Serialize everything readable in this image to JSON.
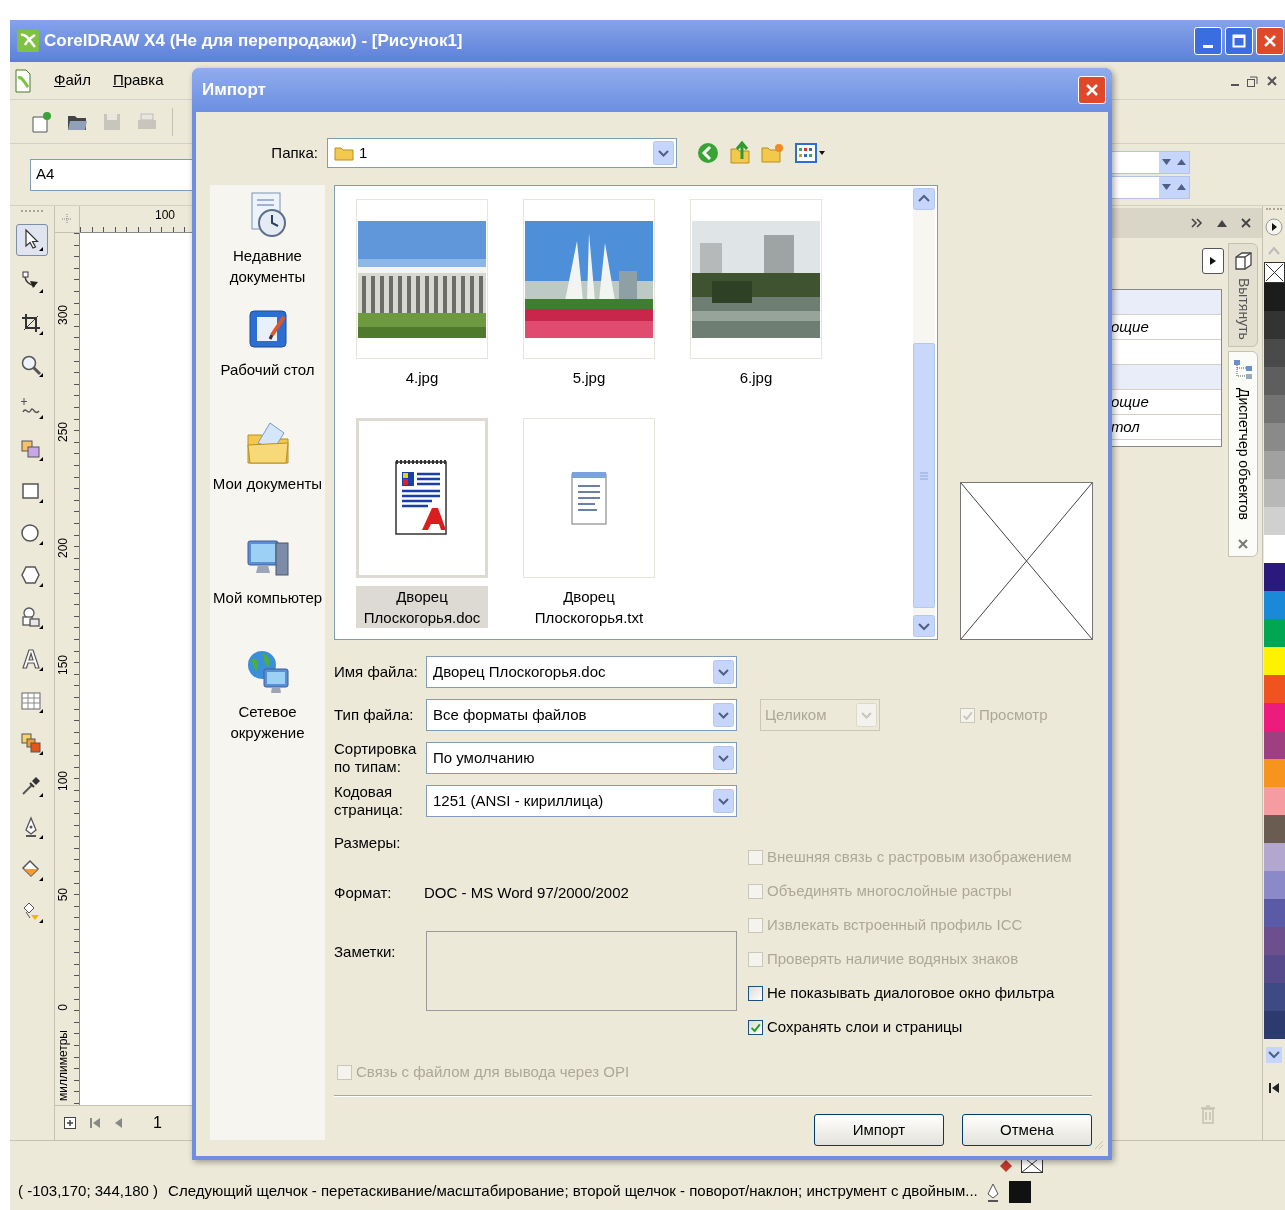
{
  "app": {
    "title": "CorelDRAW X4 (Не для перепродажи) - [Рисунок1]",
    "menu": [
      "Файл",
      "Правка"
    ],
    "page_size": "A4",
    "tools": [
      {
        "selected": true
      },
      {
        "selected": false
      },
      {
        "selected": false
      },
      {
        "selected": false
      },
      {
        "selected": false
      },
      {
        "selected": false
      },
      {
        "selected": false
      },
      {
        "selected": false
      },
      {
        "selected": false
      },
      {
        "selected": false
      },
      {
        "selected": false
      },
      {
        "selected": false
      },
      {
        "selected": false
      },
      {
        "selected": false
      },
      {
        "selected": false
      },
      {
        "selected": false
      },
      {
        "selected": false
      }
    ],
    "ruler": {
      "h_labels": [
        "100"
      ],
      "v_labels": [
        "300",
        "250",
        "200",
        "150",
        "100",
        "50",
        "0"
      ],
      "unit": "миллиметры"
    },
    "page_nav": "1",
    "docker": {
      "rows": [
        {
          "kind": "group"
        },
        {
          "kind": "item",
          "text": "ощие"
        },
        {
          "kind": "item"
        },
        {
          "kind": "group"
        },
        {
          "kind": "item",
          "text": "ощие"
        },
        {
          "kind": "item",
          "text": "тол"
        }
      ],
      "tabs": [
        {
          "label": "Вытянуть",
          "selected": false
        },
        {
          "label": "Диспетчер объектов",
          "selected": true
        }
      ]
    },
    "palette": [
      {
        "color": "#1c1c1c"
      },
      {
        "color": "#333333"
      },
      {
        "color": "#4a4a4a"
      },
      {
        "color": "#5e5e5e"
      },
      {
        "color": "#737373"
      },
      {
        "color": "#8a8a8a"
      },
      {
        "color": "#a1a1a1"
      },
      {
        "color": "#b8b8b8"
      },
      {
        "color": "#d0d0d0"
      },
      {
        "color": "#ffffff"
      },
      {
        "color": "#2b1a7c"
      },
      {
        "color": "#1a8ad8"
      },
      {
        "color": "#00a651"
      },
      {
        "color": "#fff200"
      },
      {
        "color": "#f0541e"
      },
      {
        "color": "#ec1c7d"
      },
      {
        "color": "#9e3f80"
      },
      {
        "color": "#f7941d"
      },
      {
        "color": "#f49ca0"
      },
      {
        "color": "#6b5c52"
      },
      {
        "color": "#b3a7d0"
      },
      {
        "color": "#8c89c8"
      },
      {
        "color": "#5b5aa6"
      },
      {
        "color": "#6d4f8d"
      },
      {
        "color": "#574a8b"
      },
      {
        "color": "#3e4a83"
      },
      {
        "color": "#2d3a6d"
      }
    ],
    "status_bar": {
      "coordinates": "( -103,170; 344,180 )",
      "hint": "Следующий щелчок - перетаскивание/масштабирование; второй щелчок - поворот/наклон; инструмент с двойным..."
    }
  },
  "dialog": {
    "title": "Импорт",
    "folder_label": "Папка:",
    "folder": "1",
    "places": [
      "Недавние документы",
      "Рабочий стол",
      "Мои документы",
      "Мой компьютер",
      "Сетевое окружение"
    ],
    "files": [
      {
        "name": "4.jpg",
        "selected": false
      },
      {
        "name": "5.jpg",
        "selected": false
      },
      {
        "name": "6.jpg",
        "selected": false
      },
      {
        "name": "Дворец Плоскогорья.doc",
        "kind": "doc",
        "selected": true
      },
      {
        "name": "Дворец Плоскогорья.txt",
        "kind": "txt",
        "selected": false
      }
    ],
    "fields": [
      {
        "label": "Имя файла:",
        "value": "Дворец Плоскогорья.doc"
      },
      {
        "label": "Тип файла:",
        "value": "Все форматы файлов"
      },
      {
        "label": "Сортировка по типам:",
        "value": "По умолчанию"
      },
      {
        "label": "Кодовая страница:",
        "value": "1251  (ANSI - кириллица)"
      }
    ],
    "crop": {
      "value": "Целиком",
      "disabled": true
    },
    "preview": {
      "label": "Просмотр",
      "checked": true,
      "disabled": true
    },
    "size_label": "Размеры:",
    "format_label": "Формат:",
    "format": "DOC - MS Word 97/2000/2002",
    "notes_label": "Заметки:",
    "options": [
      {
        "label": "Внешняя связь с растровым изображением",
        "checked": false,
        "disabled": true
      },
      {
        "label": "Объединять многослойные растры",
        "checked": false,
        "disabled": true
      },
      {
        "label": "Извлекать встроенный профиль ICC",
        "checked": false,
        "disabled": true
      },
      {
        "label": "Проверять наличие водяных знаков",
        "checked": false,
        "disabled": true
      },
      {
        "label": "Не показывать диалоговое окно фильтра",
        "checked": false,
        "disabled": false
      },
      {
        "label": "Сохранять слои и страницы",
        "checked": true,
        "disabled": false
      }
    ],
    "opi": {
      "label": "Связь с файлом для вывода через OPI",
      "checked": false,
      "disabled": true
    },
    "buttons": [
      "Импорт",
      "Отмена"
    ]
  }
}
